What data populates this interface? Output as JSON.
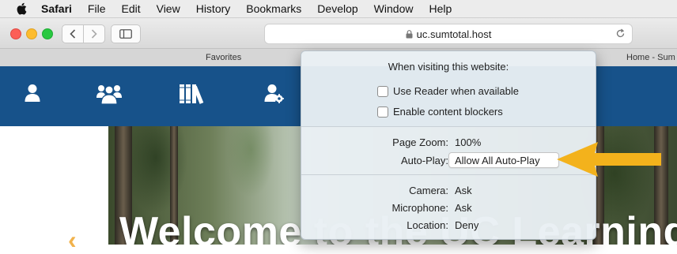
{
  "menubar": {
    "app": "Safari",
    "items": [
      "File",
      "Edit",
      "View",
      "History",
      "Bookmarks",
      "Develop",
      "Window",
      "Help"
    ]
  },
  "toolbar": {
    "url": "uc.sumtotal.host"
  },
  "favorites_bar": {
    "label": "Favorites",
    "tab_title": "Home - Sum"
  },
  "site_nav": {
    "icons": [
      "user-icon",
      "group-icon",
      "library-books-icon",
      "user-settings-icon"
    ],
    "color": "#17528a"
  },
  "hero": {
    "title": "Welcome to the UC Learning Ce"
  },
  "popover": {
    "title": "When visiting this website:",
    "checkboxes": [
      {
        "label": "Use Reader when available",
        "checked": false
      },
      {
        "label": "Enable content blockers",
        "checked": false
      }
    ],
    "page_zoom": {
      "label": "Page Zoom:",
      "value": "100%"
    },
    "auto_play": {
      "label": "Auto-Play:",
      "value": "Allow All Auto-Play"
    },
    "camera": {
      "label": "Camera:",
      "value": "Ask"
    },
    "microphone": {
      "label": "Microphone:",
      "value": "Ask"
    },
    "location": {
      "label": "Location:",
      "value": "Deny"
    }
  },
  "annotation": {
    "arrow_color": "#f3b21c"
  }
}
